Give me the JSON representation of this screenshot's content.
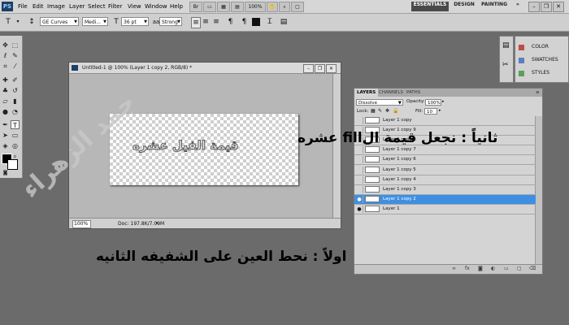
{
  "menubar": {
    "logo": "PS",
    "menus": [
      "File",
      "Edit",
      "Image",
      "Layer",
      "Select",
      "Filter",
      "View",
      "Window",
      "Help"
    ],
    "zoom": "100%",
    "workspaces": [
      "ESSENTIALS",
      "DESIGN",
      "PAINTING"
    ],
    "more": "»"
  },
  "options": {
    "font_family": "GE Curves",
    "font_style": "Medi...",
    "font_size": "36 pt",
    "antialias": "Strong",
    "color_swatch": "#111111"
  },
  "document": {
    "title": "Untitled-1 @ 100% (Layer 1 copy 2, RGB/8) *",
    "zoom": "100%",
    "doc_info": "Doc: 197.8K/7.09M",
    "canvas_text": "قيمة الفيل عشره"
  },
  "layers_panel": {
    "tabs": [
      "LAYERS",
      "CHANNELS",
      "PATHS"
    ],
    "blend_mode": "Dissolve",
    "opacity_label": "Opacity:",
    "opacity_value": "100%",
    "lock_label": "Lock:",
    "fill_label": "Fill:",
    "fill_value": "10",
    "layers": [
      {
        "name": "Layer 1 copy",
        "visible": false,
        "selected": false
      },
      {
        "name": "Layer 1 copy 9",
        "visible": false,
        "selected": false
      },
      {
        "name": "Layer 1 copy 8",
        "visible": false,
        "selected": false
      },
      {
        "name": "Layer 1 copy 7",
        "visible": false,
        "selected": false
      },
      {
        "name": "Layer 1 copy 6",
        "visible": false,
        "selected": false
      },
      {
        "name": "Layer 1 copy 5",
        "visible": false,
        "selected": false
      },
      {
        "name": "Layer 1 copy 4",
        "visible": false,
        "selected": false
      },
      {
        "name": "Layer 1 copy 3",
        "visible": false,
        "selected": false
      },
      {
        "name": "Layer 1 copy 2",
        "visible": true,
        "selected": true
      },
      {
        "name": "Layer 1",
        "visible": true,
        "selected": false
      }
    ]
  },
  "mini_panels": [
    {
      "label": "COLOR",
      "color": "#c04a4a"
    },
    {
      "label": "SWATCHES",
      "color": "#5a7fc0"
    },
    {
      "label": "STYLES",
      "color": "#5aa05a"
    }
  ],
  "annotations": {
    "step2": "ثانياً : نجعل قيمة الfill عشره",
    "step1": "اولاً : نحط العين على الشفيفه الثانيه",
    "watermark": "جمد الزهراء"
  }
}
